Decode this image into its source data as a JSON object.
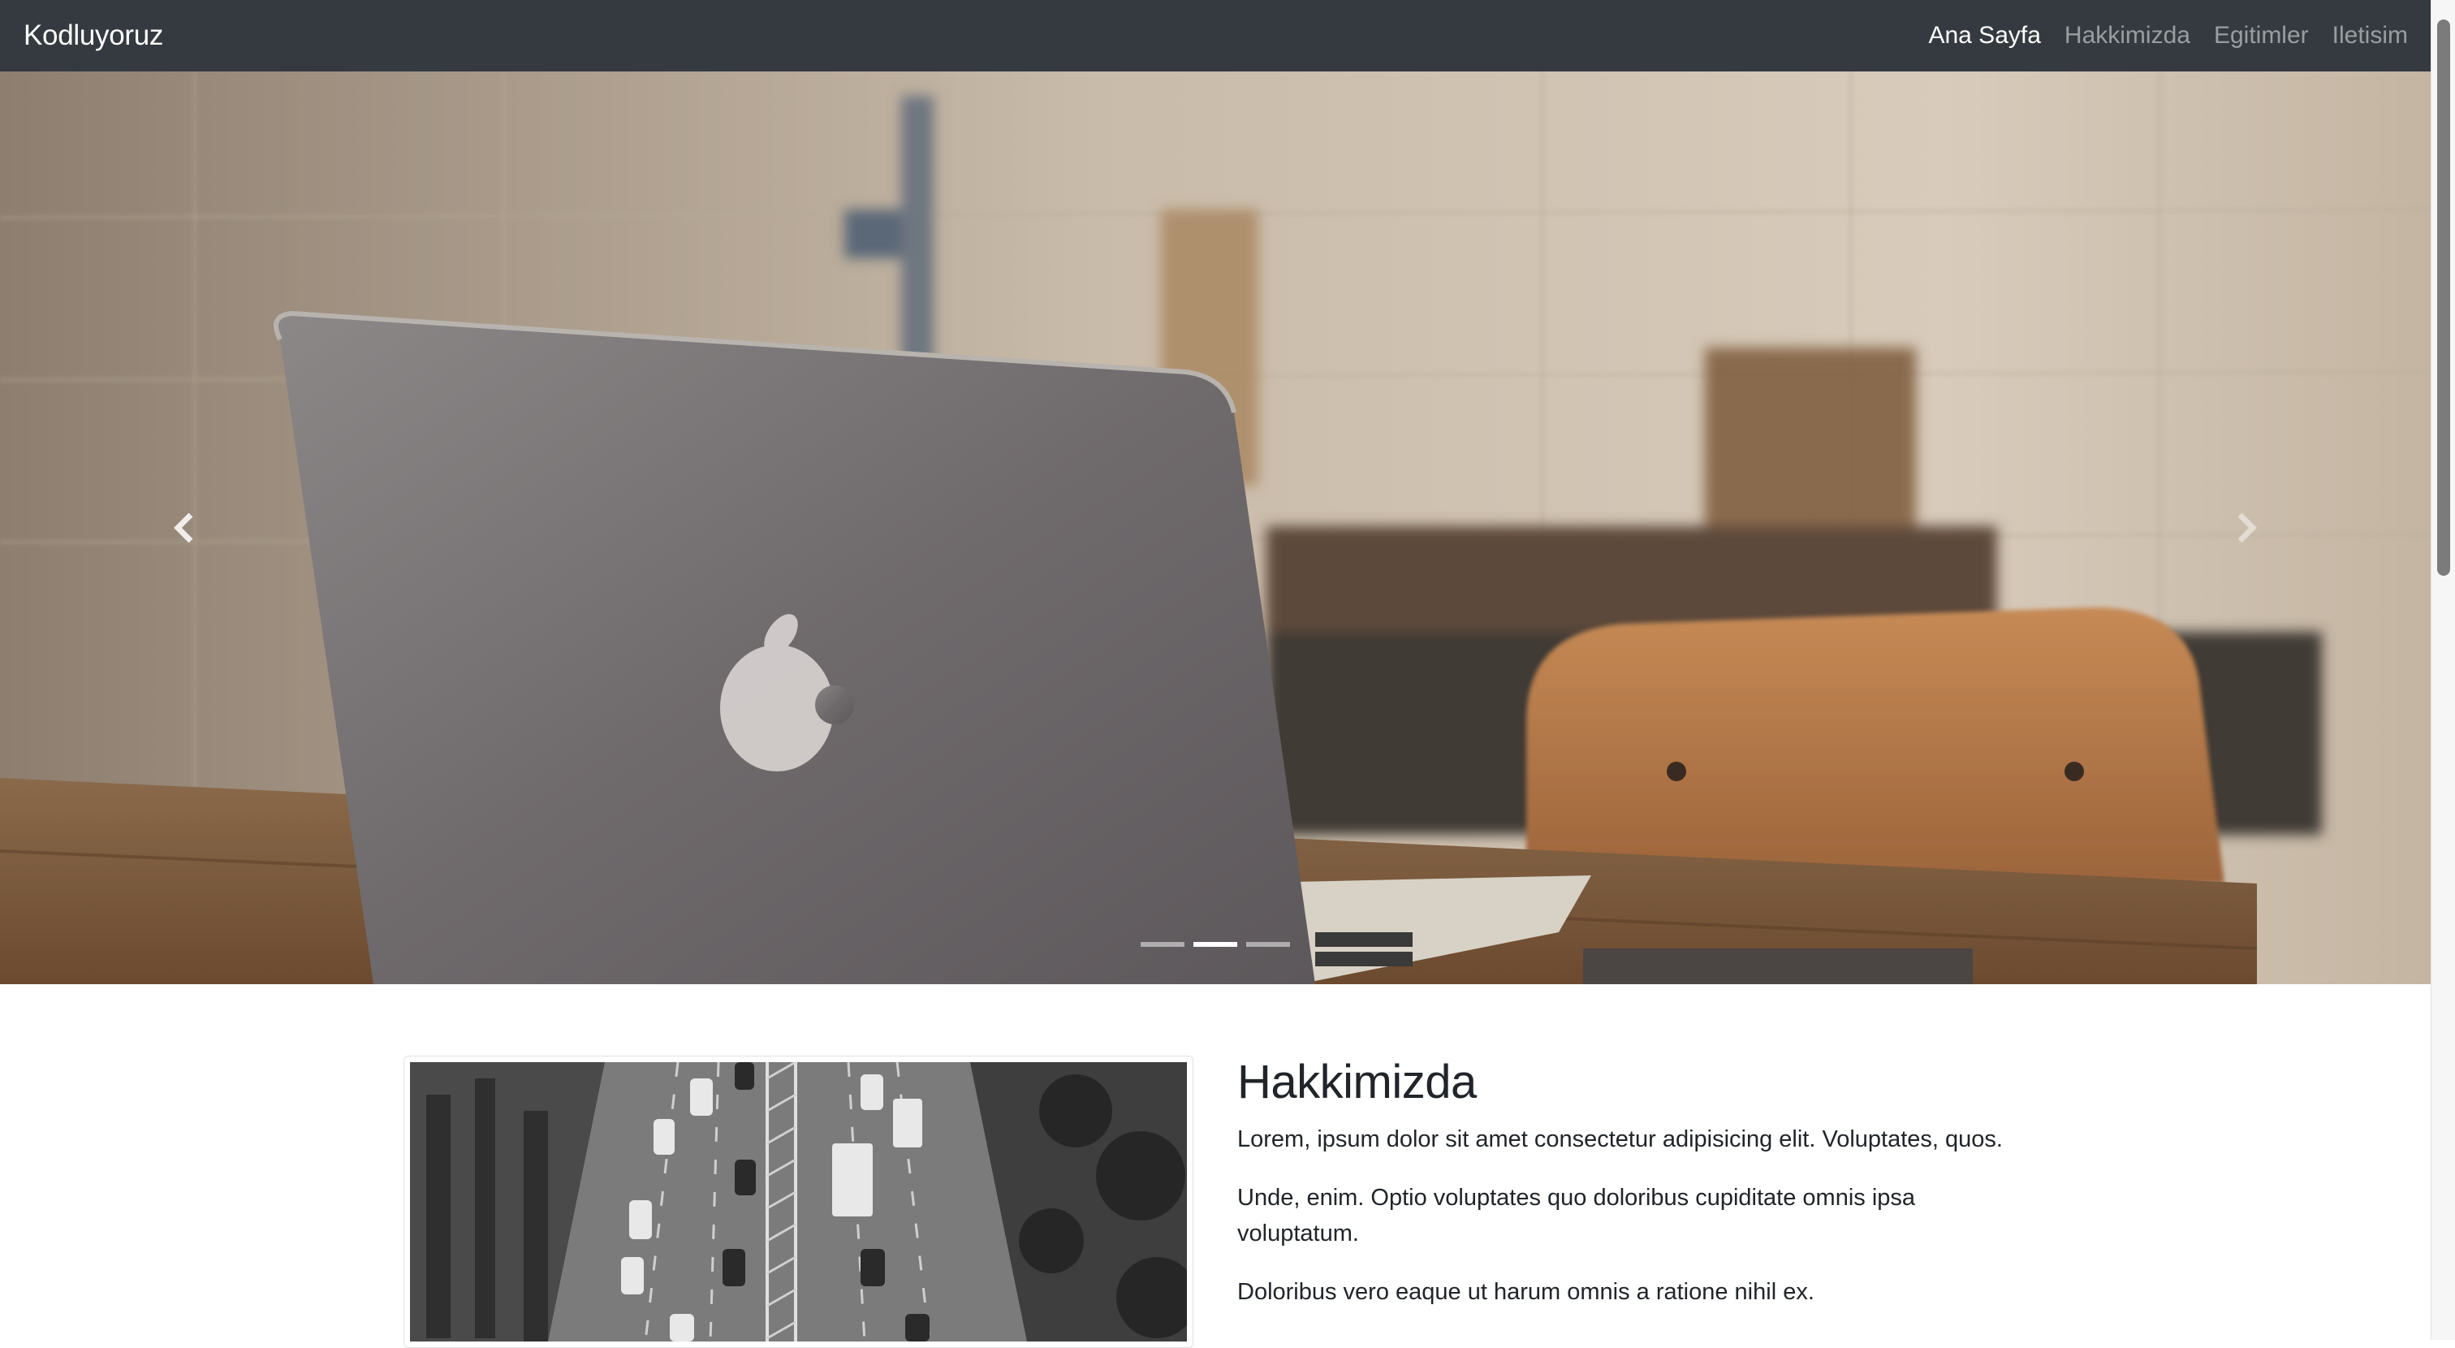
{
  "navbar": {
    "brand": "Kodluyoruz",
    "links": [
      {
        "label": "Ana Sayfa",
        "active": true
      },
      {
        "label": "Hakkimizda",
        "active": false
      },
      {
        "label": "Egitimler",
        "active": false
      },
      {
        "label": "Iletisim",
        "active": false
      }
    ]
  },
  "carousel": {
    "slide_count": 3,
    "active_slide": 2,
    "prev_icon": "chevron-left-icon",
    "next_icon": "chevron-right-icon"
  },
  "about": {
    "title": "Hakkimizda",
    "paragraphs": [
      "Lorem, ipsum dolor sit amet consectetur adipisicing elit. Voluptates, quos.",
      "Unde, enim. Optio voluptates quo doloribus cupiditate omnis ipsa voluptatum.",
      "Doloribus vero eaque ut harum omnis a ratione nihil ex."
    ]
  },
  "colors": {
    "navbar_bg": "#343a40",
    "text": "#212529",
    "nav_active": "#ffffff",
    "nav_inactive": "rgba(255,255,255,0.5)"
  }
}
